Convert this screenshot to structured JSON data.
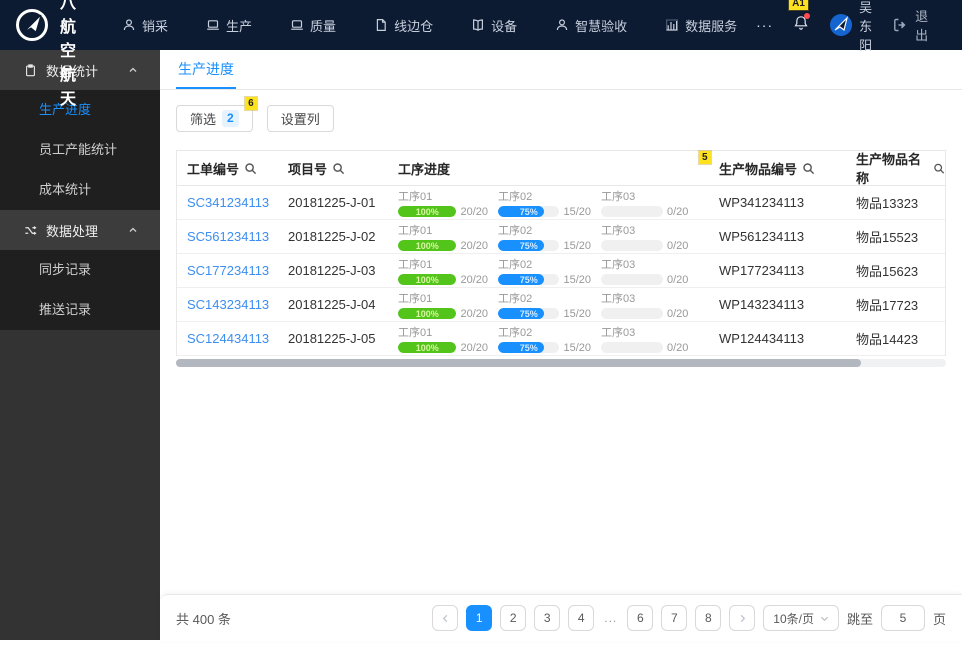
{
  "annotations": {
    "notification": "A1",
    "filter_button": "6",
    "item_code_column": "5"
  },
  "colors": {
    "accent": "#1890ff",
    "green": "#52c41a",
    "blue": "#1890ff",
    "navbar_bg": "#0c1a32",
    "sidebar_bg": "#333333",
    "submenu_bg": "#1f1f1f",
    "marker_yellow": "#ffe21f"
  },
  "navbar": {
    "brand": "一六八航空航天",
    "items": [
      {
        "label": "销采",
        "icon": "user-icon"
      },
      {
        "label": "生产",
        "icon": "laptop-icon"
      },
      {
        "label": "质量",
        "icon": "laptop-icon"
      },
      {
        "label": "线边仓",
        "icon": "file-icon"
      },
      {
        "label": "设备",
        "icon": "book-icon"
      },
      {
        "label": "智慧验收",
        "icon": "user-icon"
      },
      {
        "label": "数据服务",
        "icon": "chart-icon"
      }
    ],
    "more": "···",
    "user": "吴东阳",
    "logout": "退出"
  },
  "sidebar": {
    "groups": [
      {
        "label": "数据统计",
        "icon": "clipboard-icon",
        "items": [
          "生产进度",
          "员工产能统计",
          "成本统计"
        ]
      },
      {
        "label": "数据处理",
        "icon": "shuffle-icon",
        "items": [
          "同步记录",
          "推送记录"
        ]
      }
    ],
    "active_item": "生产进度"
  },
  "tab": {
    "label": "生产进度"
  },
  "toolbar": {
    "filter": "筛选",
    "filter_count": "2",
    "columns": "设置列"
  },
  "table": {
    "headers": [
      "工单编号",
      "项目号",
      "工序进度",
      "生产物品编号",
      "生产物品名称"
    ],
    "rows": [
      {
        "order": "SC341234113",
        "project": "20181225-J-01",
        "code": "WP341234113",
        "name": "物品13323",
        "steps": [
          {
            "name": "工序01",
            "percent": 100,
            "label": "100%",
            "count": "20/20",
            "fill": "#52c41a",
            "label_color": "#d9f7a3"
          },
          {
            "name": "工序02",
            "percent": 75,
            "label": "75%",
            "count": "15/20",
            "fill": "#1890ff",
            "label_color": "#d6ecff"
          },
          {
            "name": "工序03",
            "percent": 0,
            "label": "",
            "count": "0/20",
            "fill": "#52c41a",
            "label_color": "#ffffff"
          }
        ]
      },
      {
        "order": "SC561234113",
        "project": "20181225-J-02",
        "code": "WP561234113",
        "name": "物品15523",
        "steps": [
          {
            "name": "工序01",
            "percent": 100,
            "label": "100%",
            "count": "20/20",
            "fill": "#52c41a",
            "label_color": "#d9f7a3"
          },
          {
            "name": "工序02",
            "percent": 75,
            "label": "75%",
            "count": "15/20",
            "fill": "#1890ff",
            "label_color": "#d6ecff"
          },
          {
            "name": "工序03",
            "percent": 0,
            "label": "",
            "count": "0/20",
            "fill": "#52c41a",
            "label_color": "#ffffff"
          }
        ]
      },
      {
        "order": "SC177234113",
        "project": "20181225-J-03",
        "code": "WP177234113",
        "name": "物品15623",
        "steps": [
          {
            "name": "工序01",
            "percent": 100,
            "label": "100%",
            "count": "20/20",
            "fill": "#52c41a",
            "label_color": "#d9f7a3"
          },
          {
            "name": "工序02",
            "percent": 75,
            "label": "75%",
            "count": "15/20",
            "fill": "#1890ff",
            "label_color": "#d6ecff"
          },
          {
            "name": "工序03",
            "percent": 0,
            "label": "",
            "count": "0/20",
            "fill": "#52c41a",
            "label_color": "#ffffff"
          }
        ]
      },
      {
        "order": "SC143234113",
        "project": "20181225-J-04",
        "code": "WP143234113",
        "name": "物品17723",
        "steps": [
          {
            "name": "工序01",
            "percent": 100,
            "label": "100%",
            "count": "20/20",
            "fill": "#52c41a",
            "label_color": "#d9f7a3"
          },
          {
            "name": "工序02",
            "percent": 75,
            "label": "75%",
            "count": "15/20",
            "fill": "#1890ff",
            "label_color": "#d6ecff"
          },
          {
            "name": "工序03",
            "percent": 0,
            "label": "",
            "count": "0/20",
            "fill": "#52c41a",
            "label_color": "#ffffff"
          }
        ]
      },
      {
        "order": "SC124434113",
        "project": "20181225-J-05",
        "code": "WP124434113",
        "name": "物品14423",
        "steps": [
          {
            "name": "工序01",
            "percent": 100,
            "label": "100%",
            "count": "20/20",
            "fill": "#52c41a",
            "label_color": "#d9f7a3"
          },
          {
            "name": "工序02",
            "percent": 75,
            "label": "75%",
            "count": "15/20",
            "fill": "#1890ff",
            "label_color": "#d6ecff"
          },
          {
            "name": "工序03",
            "percent": 0,
            "label": "",
            "count": "0/20",
            "fill": "#52c41a",
            "label_color": "#ffffff"
          }
        ]
      }
    ]
  },
  "pagination": {
    "total": "共 400 条",
    "pages": [
      "1",
      "2",
      "3",
      "4",
      "...",
      "6",
      "7",
      "8"
    ],
    "active_page": "1",
    "page_size": "10条/页",
    "jump_prefix": "跳至",
    "jump_value": "5",
    "jump_suffix": "页"
  }
}
